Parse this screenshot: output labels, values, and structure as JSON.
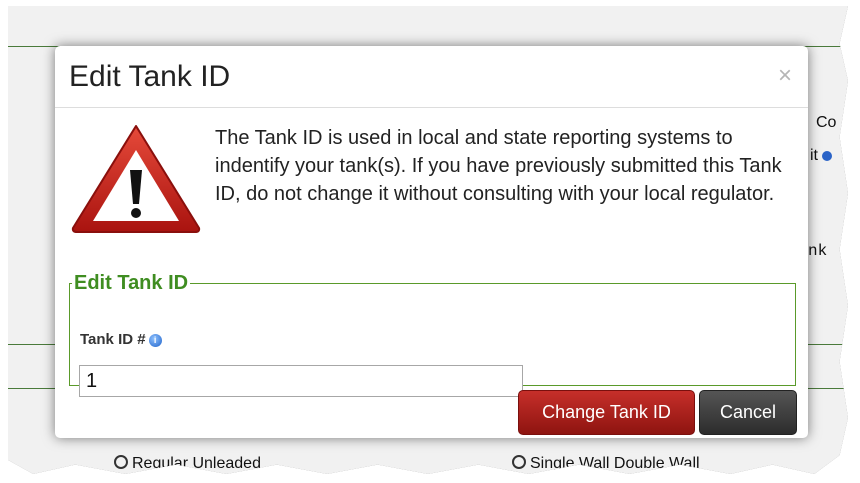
{
  "modal": {
    "title": "Edit Tank ID",
    "close_label": "×",
    "message": "The Tank ID is used in local and state reporting systems to indentify your tank(s). If you have previously submitted this Tank ID, do not change it without consulting with your local regulator.",
    "fieldset_legend": "Edit Tank ID",
    "field_label": "Tank ID #",
    "field_value": "1",
    "info_icon": "i",
    "buttons": {
      "change_label": "Change Tank ID",
      "cancel_label": "Cancel"
    }
  },
  "background": {
    "fragment_top_right": "Co",
    "fragment_it": "it",
    "fragment_mono": "nk",
    "fragment_bottom_left": "Regular Unleaded",
    "fragment_bottom_right": "Single Wall  Double Wall"
  },
  "colors": {
    "accent_green": "#3f8d21",
    "danger_red": "#b52421",
    "warning_icon_red": "#d9231f"
  }
}
